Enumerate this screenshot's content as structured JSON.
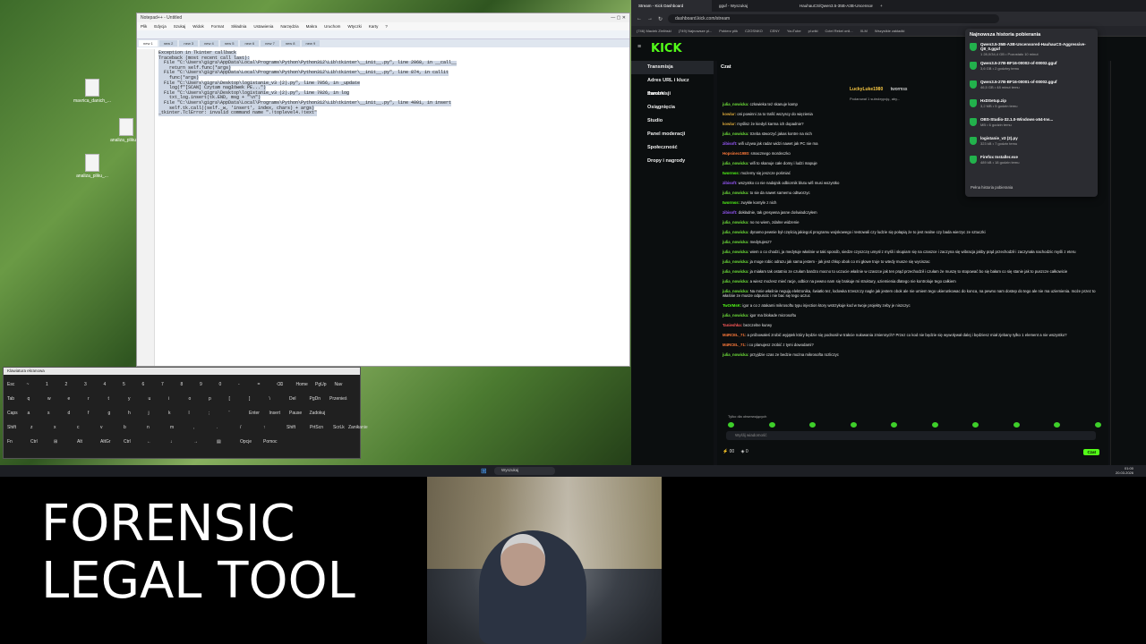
{
  "notepad": {
    "title": "Notepad++ - Untitled",
    "menu": [
      "Plik",
      "Edycja",
      "Szukaj",
      "Widok",
      "Format",
      "Składnia",
      "Ustawienia",
      "Narzędzia",
      "Makra",
      "Uruchom",
      "Wtyczki",
      "Karty",
      "?"
    ],
    "tabs": [
      "new 1",
      "new 2",
      "new 3",
      "new 4",
      "new 5",
      "new 6",
      "new 7",
      "new 8",
      "new 9"
    ],
    "lines": [
      "Exception in Tkinter callback",
      "Traceback (most recent call last):",
      "  File \"C:\\Users\\gigra\\AppData\\Local\\Programs\\Python\\Python312\\Lib\\tkinter\\__init__.py\", line 2068, in __call__",
      "    return self.func(*args)",
      "  File \"C:\\Users\\gigra\\AppData\\Local\\Programs\\Python\\Python312\\Lib\\tkinter\\__init__.py\", line 874, in callit",
      "    func(*args)",
      "  File \"C:\\Users\\gigra\\Desktop\\logistanie_v3 (2).py\", line 7056, in _update",
      "    log(f\"[SCAN] Czytam nagłówek PE...\")",
      "  File \"C:\\Users\\gigra\\Desktop\\logistanie_v3 (2).py\", line 7026, in log",
      "    txt_log.insert(tk.END, msg + \"\\n\")",
      "  File \"C:\\Users\\gigra\\AppData\\Local\\Programs\\Python\\Python312\\Lib\\tkinter\\__init__.py\", line 4001, in insert",
      "    self.tk.call((self._w, 'insert', index, chars) + args)",
      "_tkinter.TclError: invalid command name \".!toplevel4.!text\""
    ]
  },
  "keyboard": {
    "title": "Klawiatura ekranowa",
    "keys": [
      "Esc",
      "~",
      "1",
      "2",
      "3",
      "4",
      "5",
      "6",
      "7",
      "8",
      "9",
      "0",
      "-",
      "=",
      "⌫",
      "Home",
      "PgUp",
      "Nav",
      "Tab",
      "q",
      "w",
      "e",
      "r",
      "t",
      "y",
      "u",
      "i",
      "o",
      "p",
      "[",
      "]",
      "\\",
      "Del",
      "PgDn",
      "Przenieś",
      "Caps",
      "a",
      "s",
      "d",
      "f",
      "g",
      "h",
      "j",
      "k",
      "l",
      ";",
      "'",
      "Enter",
      "Insert",
      "Pause",
      "Zadokuj",
      "Shift",
      "z",
      "x",
      "c",
      "v",
      "b",
      "n",
      "m",
      ",",
      ".",
      "/",
      "↑",
      "Shift",
      "PrtScn",
      "ScrLk",
      "Zanikanie",
      "Fn",
      "Ctrl",
      "⊞",
      "Alt",
      "AltGr",
      "Ctrl",
      "←",
      "↓",
      "→",
      "▤",
      "Opcje",
      "Pomoc"
    ]
  },
  "browser": {
    "tabs": [
      "Stream - Kick Dashboard",
      "gguf - Wyszukaj",
      "HauhauCS/Qwen3.5-35B-A3B-Uncensored",
      "+"
    ],
    "address": "dashboard.kick.com/stream",
    "bookmarks": [
      "(746) Maciek Zieliński",
      "(749) Najnowsze pl...",
      "Pobierz plik",
      "CZOSNKO",
      "CENY",
      "YouTube",
      "pl.wiki",
      "Cctel Rekei onli...",
      "XLM",
      "Wszystkie zakładki"
    ]
  },
  "kick": {
    "logo": "KICK",
    "sidebar": [
      "Transmisja",
      "Adres URL i klucz transmisji",
      "Zarobki",
      "Osiągnięcia",
      "Studio",
      "Panel moderacji",
      "Społeczność",
      "Dropy i nagrody"
    ],
    "chat_title": "Czat",
    "pinned_user": "LuckyLuke1980",
    "pinned_target": "twormss",
    "pinned_text": "Podarował 1 subskrypcję, aby..."
  },
  "chat": {
    "messages": [
      {
        "user": "julia_nowicka:",
        "text": "człowieka też skanuje kamp",
        "color": "#6fe13a"
      },
      {
        "user": "kowlar:",
        "text": "oni powinni za to trafić wszyscy do więzienia",
        "color": "#d9a73a"
      },
      {
        "user": "kowlar:",
        "text": "myślisz że kiedyś karma ich dopadnie?",
        "color": "#d9a73a"
      },
      {
        "user": "julia_nowicka:",
        "text": "trzeba stworzyć jakas kontre na nich",
        "color": "#6fe13a"
      },
      {
        "user": "zibisoft:",
        "text": "wifi używa jak radar widzi nawet jak PC nie ma",
        "color": "#9b59ff"
      },
      {
        "user": "Hopsinex1980:",
        "text": "smacznego mordeczko",
        "color": "#ff7a3a"
      },
      {
        "user": "julia_nowicka:",
        "text": "wifi to skanuje całe domy i ludzi mapuje",
        "color": "#6fe13a"
      },
      {
        "user": "twormss:",
        "text": "możemy się jeszcze pośmiać",
        "color": "#53fc18"
      },
      {
        "user": "zibisoft:",
        "text": "wszystko co nie nadajnik odbiornik blutu wifi musi wszystko",
        "color": "#9b59ff"
      },
      {
        "user": "julia_nowicka:",
        "text": "to sie da nawet samemu odtworzyc",
        "color": "#6fe13a"
      },
      {
        "user": "twormss:",
        "text": "zwykłe kontyle z nich",
        "color": "#53fc18"
      },
      {
        "user": "zibisoft:",
        "text": "dokładnie, tak gresywna jasne doświadczyłem",
        "color": "#9b59ff"
      },
      {
        "user": "julia_nowicka:",
        "text": "no no wiem, zdalne widzenie",
        "color": "#6fe13a"
      },
      {
        "user": "julia_nowicka:",
        "text": "dynamo pewnie był częścią jakiegoś programu wojskowego i testowali czy ludzie się połapią że to jest realne czy bada wierzyc ze sztuczki",
        "color": "#6fe13a"
      },
      {
        "user": "julia_nowicka:",
        "text": "medytujesz?",
        "color": "#6fe13a"
      },
      {
        "user": "julia_nowicka:",
        "text": "wiem o co chodzi, ja medytuje właśnie w taki sposób, siedze czyszczę umysł z myśli i skupiam się na czaszce i zaczyna się wibracja jakby prąd przechodził i zaczynała nachodzic myśli z eteru",
        "color": "#6fe13a"
      },
      {
        "user": "julia_nowicka:",
        "text": "ja moge robic odrazu jak sama jestem - jak jest chłop obok co mi głowe truje to wtedy musze się wyciszac",
        "color": "#6fe13a"
      },
      {
        "user": "julia_nowicka:",
        "text": "ja miałam tak ostatnio ze czułam bardzo mocno to uczucie właśnie w czaszce jak ten prąd przechodził i czułam że muszę to stopować bo się bałam co się stanie jak to puszcze całkowicie",
        "color": "#6fe13a"
      },
      {
        "user": "julia_nowicka:",
        "text": "a wiesz możesz mieć racje, odbior na pewno nam się brakuje mi struktury, uziemienia dlatego nie kontroluje tego całkiem",
        "color": "#6fe13a"
      },
      {
        "user": "julia_nowicka:",
        "text": "Na mnie właśnie negują elektronika, światło tez, lodowka trzeszczy nagle jak jestem obok ale nie umiem tego ukierunkowac do konca, na pewno nam dostep do tego ale nie ma uziemienia. może przez to właśnie ze musze odpuscic i nie bac się tego uczuc",
        "color": "#6fe13a"
      },
      {
        "user": "TwOrMsK:",
        "text": "igor a co z atakami mikrosoftu typu injection ktory wstrzykuje kod w twoje projekty zeby je niszczyc",
        "color": "#53fc18"
      },
      {
        "user": "julia_nowicka:",
        "text": "igor ma blokade microsoftu",
        "color": "#6fe13a"
      },
      {
        "user": "Tanieshka:",
        "text": "bezczelne kurwy",
        "color": "#ff5a5a"
      },
      {
        "user": "M4RCEL_71:",
        "text": "a próbowałeś zrobić wyjątek który będzie się podnosił w trakcie nułowania zmiennych? Przez co kod nie będzie się wywoływał dalej i będziesz miał zjebany tylko 1 element a nie wszystko?",
        "color": "#ff7a3a"
      },
      {
        "user": "M4RCEL_71:",
        "text": "i co planujesz zrobić z tymi dowodami?",
        "color": "#ff7a3a"
      },
      {
        "user": "julia_nowicka:",
        "text": "przyjdzie czas ze bedzie można mikrosofta rozliczyc",
        "color": "#6fe13a"
      }
    ],
    "only_followers": "Tylko dla obserwujących",
    "input_placeholder": "Wyślij wiadomość",
    "footer_count_1": "00",
    "footer_count_2": "0",
    "send_label": "Czat"
  },
  "downloads": {
    "title": "Najnowsza historia pobierania",
    "items": [
      {
        "name": "Qwen3.5-35B-A3B-Uncensored-HauhauCS-Aggressive-Q8_0.gguf",
        "meta": "1 28,0/34,4 GB • Pozostało 10 minut"
      },
      {
        "name": "Qwen3.5-27B-BF16-00002-of-00002.gguf",
        "meta": "3,6 GB • 2 godziny temu"
      },
      {
        "name": "Qwen3.5-27B-BF16-00001-of-00002.gguf",
        "meta": "46,5 GB • 48 minut temu"
      },
      {
        "name": "HxDSetup.zip",
        "meta": "3,2 MB • 5 godzin temu"
      },
      {
        "name": "OBS-Studio-32.1.0-Windows-x64-Ins...",
        "meta": "MB • 6 godzin temu"
      },
      {
        "name": "logistanie_v3 (2).py",
        "meta": "323 kB • 7 godzin temu"
      },
      {
        "name": "Firefox Installer.exe",
        "meta": "489 kB • 18 godzin temu"
      }
    ],
    "full_history": "Pełna historia pobierania"
  },
  "taskbar": {
    "search": "Wyszukaj",
    "time": "01:00",
    "date": "20.03.2026"
  },
  "desktop_icons": [
    "mavrica_danich_...",
    "analiza_pliku_...",
    "analiza_pliku_..."
  ],
  "overlay": {
    "line1": "FORENSIC",
    "line2": "LEGAL TOOL"
  }
}
